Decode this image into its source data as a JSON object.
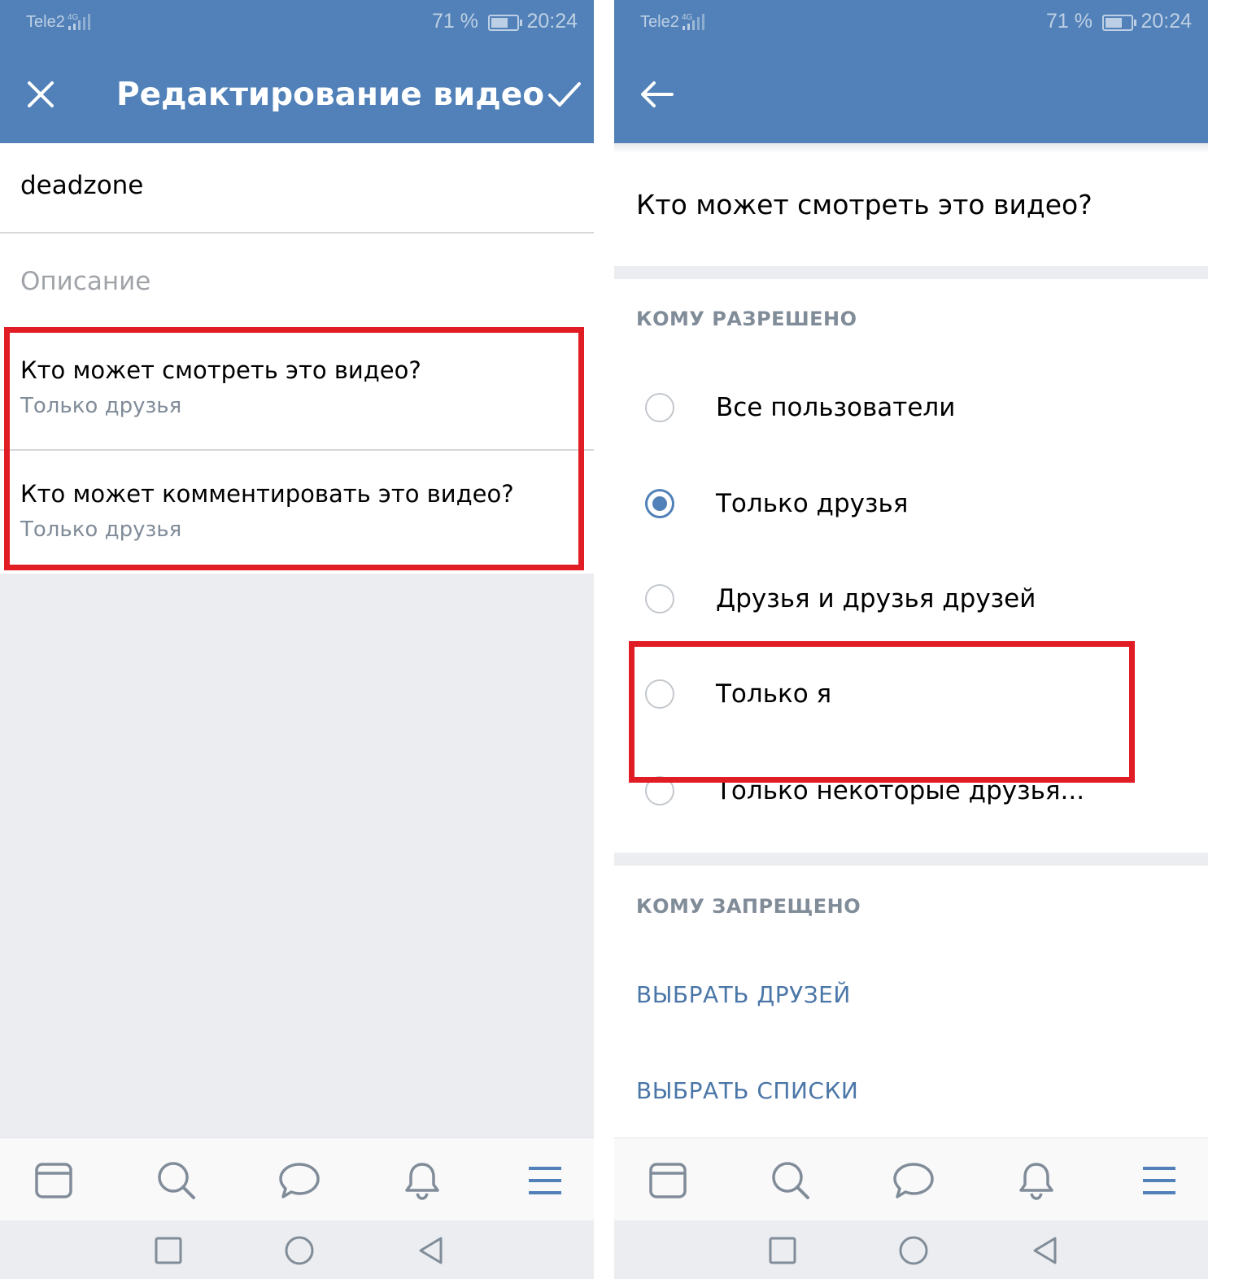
{
  "colors": {
    "header_blue": "#5181b8",
    "highlight_red": "#e01d25",
    "link_blue": "#4a76a8",
    "secondary_text": "#818c99",
    "background_gray": "#ebedf0"
  },
  "status_bar": {
    "carrier": "Tele2",
    "network": "4G",
    "battery_percent": "71 %",
    "battery_level": 0.71,
    "time": "20:24"
  },
  "edit_screen": {
    "title": "Редактирование видео",
    "close_icon": "close-icon",
    "confirm_icon": "checkmark-icon",
    "name_field": {
      "value": "deadzone"
    },
    "description_field": {
      "placeholder": "Описание"
    },
    "settings": [
      {
        "title": "Кто может смотреть это видео?",
        "value": "Только друзья"
      },
      {
        "title": "Кто может комментировать это видео?",
        "value": "Только друзья"
      }
    ]
  },
  "privacy_screen": {
    "back_icon": "arrow-left-icon",
    "question": "Кто может смотреть это видео?",
    "allowed_header": "КОМУ РАЗРЕШЕНО",
    "options": [
      {
        "label": "Все пользователи",
        "selected": false
      },
      {
        "label": "Только друзья",
        "selected": true
      },
      {
        "label": "Друзья и друзья друзей",
        "selected": false
      },
      {
        "label": "Только я",
        "selected": false
      },
      {
        "label": "Только некоторые друзья...",
        "selected": false
      }
    ],
    "forbidden_header": "КОМУ ЗАПРЕЩЕНО",
    "actions": [
      "ВЫБРАТЬ ДРУЗЕЙ",
      "ВЫБРАТЬ СПИСКИ"
    ]
  },
  "tab_bar": {
    "items": [
      "newsfeed-icon",
      "search-icon",
      "messages-icon",
      "notifications-icon",
      "menu-icon"
    ]
  },
  "nav_bar": {
    "items": [
      "recents-icon",
      "home-icon",
      "back-icon"
    ]
  }
}
